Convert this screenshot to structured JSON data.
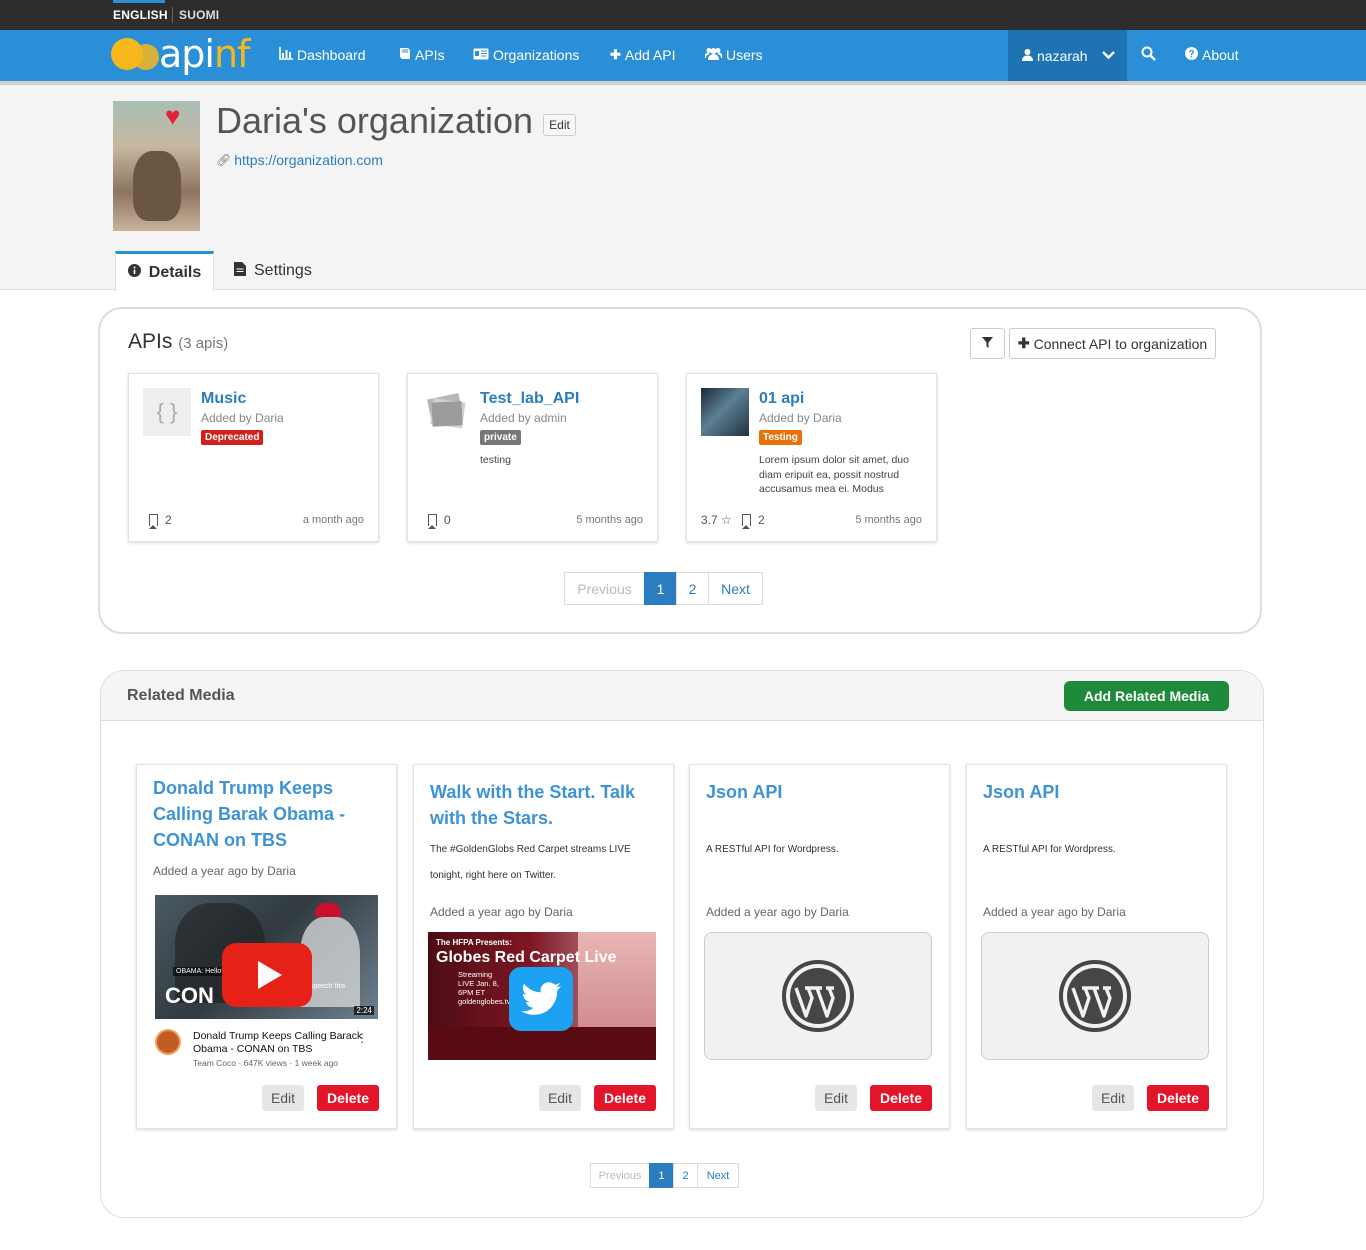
{
  "lang": {
    "english": "ENGLISH",
    "suomi": "SUOMI"
  },
  "nav": {
    "logo": "apinf",
    "items": [
      "Dashboard",
      "APIs",
      "Organizations",
      "Add API",
      "Users"
    ],
    "user": "nazarah",
    "about": "About"
  },
  "org": {
    "title": "Daria's organization",
    "edit": "Edit",
    "url": "https://organization.com"
  },
  "tabs": {
    "details": "Details",
    "settings": "Settings"
  },
  "apis": {
    "title": "APIs",
    "count": "(3 apis)",
    "connect": "Connect API to organization",
    "cards": [
      {
        "name": "Music",
        "added": "Added by Daria",
        "badge": "Deprecated",
        "badge_color": "#d0221c",
        "desc": "",
        "rating": "",
        "bookmarks": "2",
        "time": "a month ago"
      },
      {
        "name": "Test_lab_API",
        "added": "Added by admin",
        "badge": "private",
        "badge_color": "#777777",
        "desc": "testing",
        "rating": "",
        "bookmarks": "0",
        "time": "5 months ago"
      },
      {
        "name": "01 api",
        "added": "Added by Daria",
        "badge": "Testing",
        "badge_color": "#e8710a",
        "desc": "Lorem ipsum dolor sit amet, duo diam eripuit ea, possit nostrud accusamus mea ei. Modus",
        "rating": "3.7",
        "bookmarks": "2",
        "time": "5 months ago"
      }
    ],
    "pager": {
      "prev": "Previous",
      "p1": "1",
      "p2": "2",
      "next": "Next"
    }
  },
  "media": {
    "title": "Related Media",
    "add": "Add Related Media",
    "edit": "Edit",
    "delete": "Delete",
    "cards": [
      {
        "title": "Donald Trump Keeps Calling Barak Obama -  CONAN on TBS",
        "desc": "",
        "added": "Added a year ago by Daria",
        "video_title": "Donald Trump Keeps Calling Barack Obama  - CONAN on TBS",
        "video_sub": "Team Coco · 647K views · 1 week ago",
        "video_duration": "2:24",
        "video_overlay_left": "CON",
        "video_overlay_caption": "OBAMA: Hello?",
        "video_overlay_right": "speech this"
      },
      {
        "title": "Walk with the Start. Talk with the Stars.",
        "desc": "The #GoldenGlobs Red Carpet streams LIVE tonight, right here on Twitter.",
        "added": "Added a year ago by Daria",
        "tw_presents": "The HFPA Presents:",
        "tw_headline": "Globes Red Carpet Live",
        "tw_info": "Streaming LIVE Jan. 8, 6PM ET goldenglobes.tv"
      },
      {
        "title": "Json API",
        "desc": "A  RESTful API for Wordpress.",
        "added": "Added a year ago by Daria"
      },
      {
        "title": "Json API",
        "desc": "A  RESTful API for Wordpress.",
        "added": "Added a year ago by Daria"
      }
    ],
    "pager": {
      "prev": "Previous",
      "p1": "1",
      "p2": "2",
      "next": "Next"
    }
  }
}
